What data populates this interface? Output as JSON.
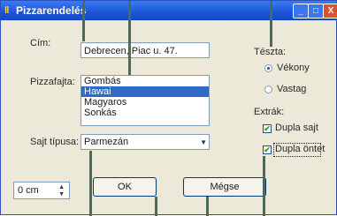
{
  "window": {
    "title": "Pizzarendelés",
    "icon": "pizza-icon",
    "minimize_glyph": "_",
    "maximize_glyph": "□",
    "close_glyph": "X"
  },
  "form": {
    "address_label": "Cím:",
    "address_value": "Debrecen, Piac u. 47.",
    "pizza_label": "Pizzafajta:",
    "pizza_options": [
      "Gombás",
      "Hawai",
      "Magyaros",
      "Sonkás"
    ],
    "pizza_selected": "Hawai",
    "cheese_label": "Sajt típusa:",
    "cheese_value": "Parmezán",
    "dough_label": "Tészta:",
    "dough_options": [
      "Vékony",
      "Vastag"
    ],
    "dough_selected": "Vékony",
    "extras_label": "Extrák:",
    "extras": [
      {
        "label": "Dupla sajt",
        "checked": true
      },
      {
        "label": "Dupla öntet",
        "checked": true
      }
    ],
    "size_value": "0 cm",
    "ok_label": "OK",
    "cancel_label": "Mégse"
  }
}
